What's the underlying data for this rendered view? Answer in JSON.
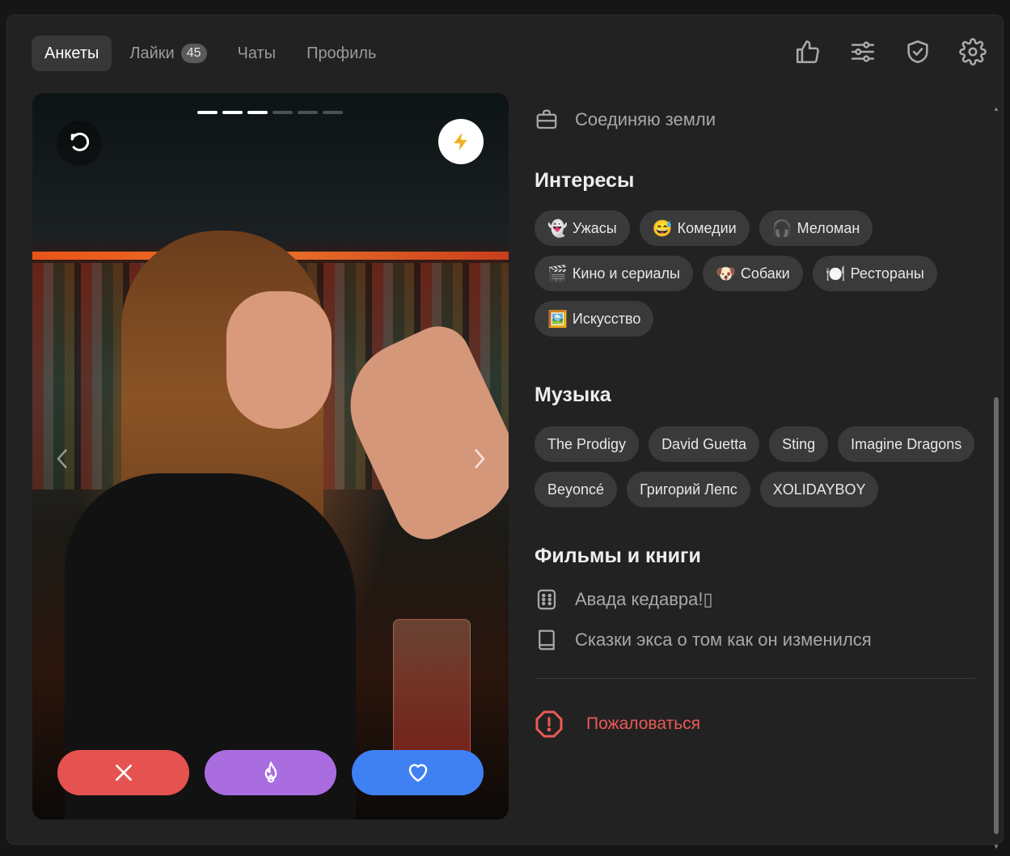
{
  "nav": {
    "tabs": [
      {
        "label": "Анкеты",
        "active": true
      },
      {
        "label": "Лайки",
        "badge": "45"
      },
      {
        "label": "Чаты"
      },
      {
        "label": "Профиль"
      }
    ],
    "icons": [
      "thumbs-up-icon",
      "sliders-icon",
      "shield-check-icon",
      "gear-icon"
    ]
  },
  "photo": {
    "slides_total": 6,
    "slides_current": 3,
    "actions": {
      "dislike_color": "#e5524f",
      "super_color": "#a96de0",
      "like_color": "#3f80f2"
    }
  },
  "profile": {
    "job": "Соединяю земли",
    "interests_title": "Интересы",
    "interests": [
      {
        "emoji": "👻",
        "label": "Ужасы"
      },
      {
        "emoji": "😅",
        "label": "Комедии"
      },
      {
        "emoji": "🎧",
        "label": "Меломан"
      },
      {
        "emoji": "🎬",
        "label": "Кино и сериалы"
      },
      {
        "emoji": "🐶",
        "label": "Собаки"
      },
      {
        "emoji": "🍽️",
        "label": "Рестораны"
      },
      {
        "emoji": "🖼️",
        "label": "Искусство"
      }
    ],
    "music_title": "Музыка",
    "music": [
      "The Prodigy",
      "David Guetta",
      "Sting",
      "Imagine Dragons",
      "Beyoncé",
      "Григорий Лепс",
      "XOLIDAYBOY"
    ],
    "films_title": "Фильмы и книги",
    "film": "Авада кедавра!▯",
    "book": "Сказки экса о том как он изменился",
    "report": "Пожаловаться"
  }
}
